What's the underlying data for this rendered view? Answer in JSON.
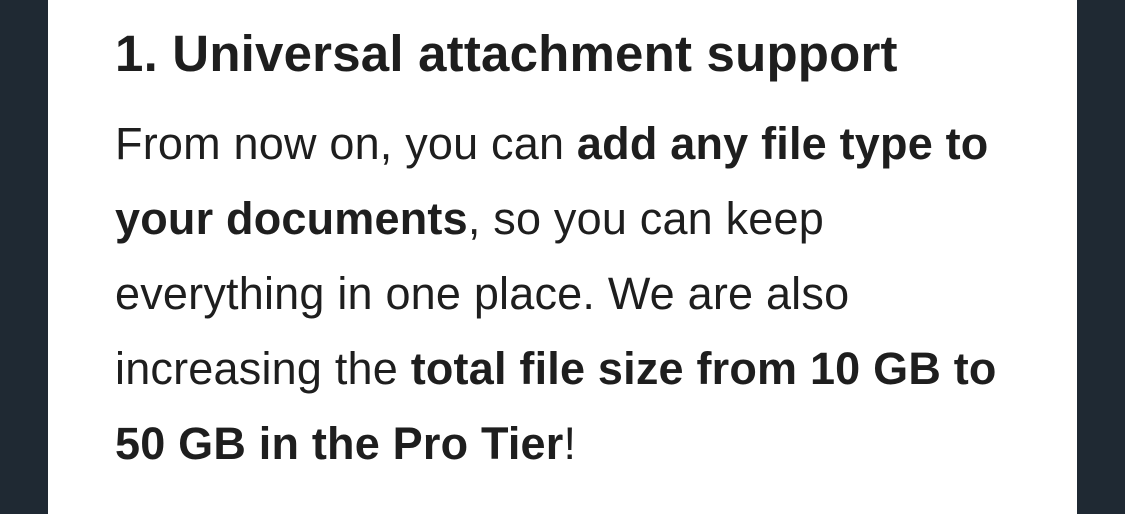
{
  "colors": {
    "backdrop": "#1f2933",
    "card": "#ffffff",
    "text": "#1e1e1e"
  },
  "section": {
    "heading": "1. Universal attachment support",
    "paragraph": {
      "part1": "From now on, you can ",
      "bold1": "add any file type to your documents",
      "part2": ", so you can keep everything in one place. We are also increasing the ",
      "bold2": "total file size from 10 GB to 50 GB in the Pro Tier",
      "part3": "!"
    }
  }
}
